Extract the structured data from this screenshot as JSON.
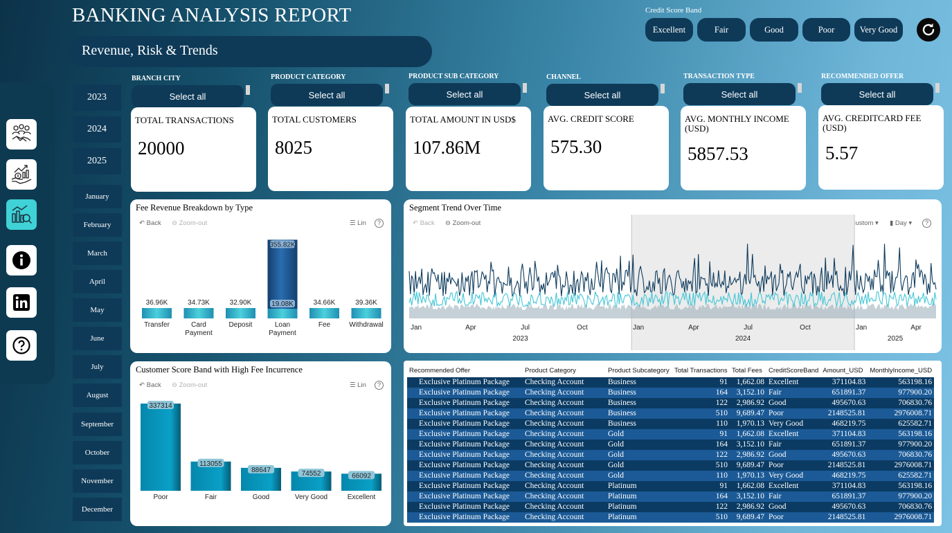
{
  "header": {
    "title": "BANKING ANALYSIS REPORT",
    "subtitle": "Revenue, Risk & Trends"
  },
  "credit_score_band": {
    "label": "Credit Score Band",
    "options": [
      "Excellent",
      "Fair",
      "Good",
      "Poor",
      "Very Good"
    ]
  },
  "nav": {
    "icons": [
      "handshake-icon",
      "money-growth-icon",
      "analytics-icon",
      "info-icon",
      "linkedin-icon",
      "help-icon"
    ],
    "active": "analytics-icon"
  },
  "years": [
    "2023",
    "2024",
    "2025"
  ],
  "months": [
    "January",
    "February",
    "March",
    "April",
    "May",
    "June",
    "July",
    "August",
    "September",
    "October",
    "November",
    "December"
  ],
  "slicers": [
    {
      "label": "BRANCH CITY",
      "value": "Select all"
    },
    {
      "label": "PRODUCT CATEGORY",
      "value": "Select all"
    },
    {
      "label": "PRODUCT SUB CATEGORY",
      "value": "Select all"
    },
    {
      "label": "CHANNEL",
      "value": "Select all"
    },
    {
      "label": "TRANSACTION TYPE",
      "value": "Select all"
    },
    {
      "label": "RECOMMENDED OFFER",
      "value": "Select all"
    }
  ],
  "kpis": [
    {
      "label": "TOTAL TRANSACTIONS",
      "value": "20000"
    },
    {
      "label": "TOTAL CUSTOMERS",
      "value": "8025"
    },
    {
      "label": "TOTAL AMOUNT IN USD$",
      "value": "107.86M"
    },
    {
      "label": "AVG. CREDIT SCORE",
      "value": "575.30"
    },
    {
      "label": "AVG. MONTHLY INCOME (USD)",
      "value": "5857.53"
    },
    {
      "label": "AVG. CREDITCARD FEE (USD)",
      "value": "5.57"
    }
  ],
  "toolbar": {
    "back": "Back",
    "zoom_out": "Zoom-out",
    "lin": "Lin",
    "custom": "Custom",
    "day": "Day",
    "help": "?"
  },
  "fee_panel_title": "Fee Revenue Breakdown by Type",
  "score_panel_title": "Customer Score Band with High Fee Incurrence",
  "trend_panel_title": "Segment Trend Over Time",
  "chart_data": [
    {
      "type": "bar",
      "title": "Fee Revenue Breakdown by Type",
      "categories": [
        "Transfer",
        "Card Payment",
        "Deposit",
        "Loan Payment",
        "Fee",
        "Withdrawal"
      ],
      "category_lines": [
        [
          "Transfer"
        ],
        [
          "Card",
          "Payment"
        ],
        [
          "Deposit"
        ],
        [
          "Loan",
          "Payment"
        ],
        [
          "Fee"
        ],
        [
          "Withdrawal"
        ]
      ],
      "values": [
        36960,
        34730,
        32900,
        355820,
        34660,
        39360
      ],
      "value_labels": [
        "36.96K",
        "34.73K",
        "32.90K",
        "355.82K",
        "34.66K",
        "39.36K"
      ],
      "inner_labels": [
        "",
        "",
        "",
        "19.08K",
        "",
        ""
      ],
      "ylim": [
        0,
        360000
      ],
      "colors": {
        "highlight": "#1b5a96",
        "base": "#2aa9c4"
      }
    },
    {
      "type": "bar",
      "title": "Customer Score Band with High Fee Incurrence",
      "categories": [
        "Poor",
        "Fair",
        "Good",
        "Very Good",
        "Excellent"
      ],
      "values": [
        337314,
        113055,
        88647,
        74552,
        66092
      ],
      "value_labels": [
        "337314",
        "113055",
        "88647",
        "74552",
        "66092"
      ],
      "ylim": [
        0,
        340000
      ],
      "colors": {
        "bar": "#0592b8"
      }
    },
    {
      "type": "line",
      "title": "Segment Trend Over Time",
      "x_ticks": [
        "Jan",
        "Apr",
        "Jul",
        "Oct",
        "Jan",
        "Apr",
        "Jul",
        "Oct",
        "Jan",
        "Apr"
      ],
      "x_groups": [
        "2023",
        "2024",
        "2025"
      ],
      "x_range": [
        "2023-01-01",
        "2025-05-15"
      ],
      "series_colors": [
        "#0d3a5c",
        "#44c6d6",
        "#9fb0bd"
      ]
    }
  ],
  "table": {
    "columns": [
      "Recommended Offer",
      "Product Category",
      "Product Subcategory",
      "Total Transactions",
      "Total Fees",
      "CreditScoreBand",
      "Amount_USD",
      "MonthlyIncome_USD"
    ],
    "rows": [
      [
        "Exclusive Platinum Package",
        "Checking Account",
        "Business",
        "91",
        "1,662.08",
        "Excellent",
        "371104.83",
        "563198.16"
      ],
      [
        "Exclusive Platinum Package",
        "Checking Account",
        "Business",
        "164",
        "3,152.10",
        "Fair",
        "651891.37",
        "977900.20"
      ],
      [
        "Exclusive Platinum Package",
        "Checking Account",
        "Business",
        "122",
        "2,986.92",
        "Good",
        "495670.63",
        "706830.76"
      ],
      [
        "Exclusive Platinum Package",
        "Checking Account",
        "Business",
        "510",
        "9,689.47",
        "Poor",
        "2148525.81",
        "2976008.71"
      ],
      [
        "Exclusive Platinum Package",
        "Checking Account",
        "Business",
        "110",
        "1,970.13",
        "Very Good",
        "468219.75",
        "625582.71"
      ],
      [
        "Exclusive Platinum Package",
        "Checking Account",
        "Gold",
        "91",
        "1,662.08",
        "Excellent",
        "371104.83",
        "563198.16"
      ],
      [
        "Exclusive Platinum Package",
        "Checking Account",
        "Gold",
        "164",
        "3,152.10",
        "Fair",
        "651891.37",
        "977900.20"
      ],
      [
        "Exclusive Platinum Package",
        "Checking Account",
        "Gold",
        "122",
        "2,986.92",
        "Good",
        "495670.63",
        "706830.76"
      ],
      [
        "Exclusive Platinum Package",
        "Checking Account",
        "Gold",
        "510",
        "9,689.47",
        "Poor",
        "2148525.81",
        "2976008.71"
      ],
      [
        "Exclusive Platinum Package",
        "Checking Account",
        "Gold",
        "110",
        "1,970.13",
        "Very Good",
        "468219.75",
        "625582.71"
      ],
      [
        "Exclusive Platinum Package",
        "Checking Account",
        "Platinum",
        "91",
        "1,662.08",
        "Excellent",
        "371104.83",
        "563198.16"
      ],
      [
        "Exclusive Platinum Package",
        "Checking Account",
        "Platinum",
        "164",
        "3,152.10",
        "Fair",
        "651891.37",
        "977900.20"
      ],
      [
        "Exclusive Platinum Package",
        "Checking Account",
        "Platinum",
        "122",
        "2,986.92",
        "Good",
        "495670.63",
        "706830.76"
      ],
      [
        "Exclusive Platinum Package",
        "Checking Account",
        "Platinum",
        "510",
        "9,689.47",
        "Poor",
        "2148525.81",
        "2976008.71"
      ]
    ]
  }
}
